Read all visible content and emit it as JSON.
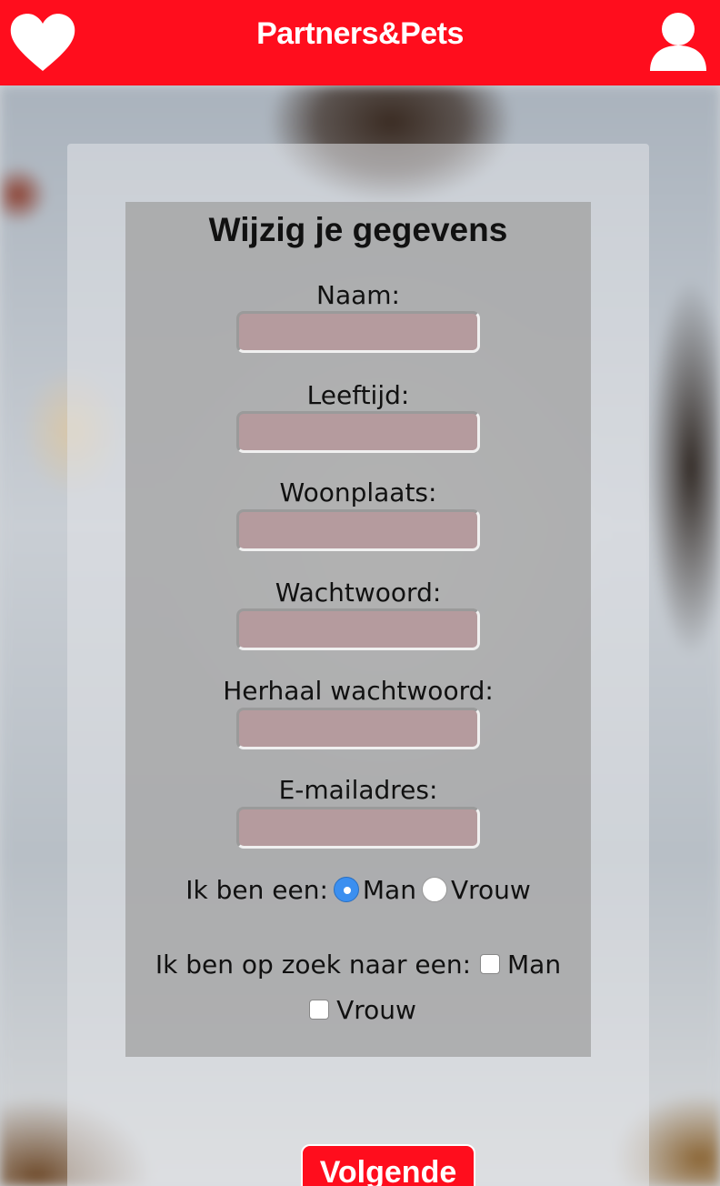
{
  "header": {
    "brand": "Partners&Pets",
    "left_icon": "heart-icon",
    "right_icon": "user-icon",
    "color": "#ff0d1d"
  },
  "form": {
    "title": "Wijzig je gegevens",
    "fields": [
      {
        "label": "Naam:",
        "value": "",
        "placeholder": ""
      },
      {
        "label": "Leeftijd:",
        "value": "",
        "placeholder": ""
      },
      {
        "label": "Woonplaats:",
        "value": "",
        "placeholder": ""
      },
      {
        "label": "Wachtwoord:",
        "value": "",
        "placeholder": ""
      },
      {
        "label": "Herhaal wachtwoord:",
        "value": "",
        "placeholder": ""
      },
      {
        "label": "E-mailadres:",
        "value": "",
        "placeholder": ""
      }
    ],
    "gender": {
      "label": "Ik ben een:",
      "options": [
        {
          "label": "Man",
          "checked": true
        },
        {
          "label": "Vrouw",
          "checked": false
        }
      ]
    },
    "looking_for": {
      "label": "Ik ben op zoek naar een:",
      "options": [
        {
          "label": "Man",
          "checked": false
        },
        {
          "label": "Vrouw",
          "checked": false
        }
      ]
    },
    "next_button": "Volgende"
  }
}
